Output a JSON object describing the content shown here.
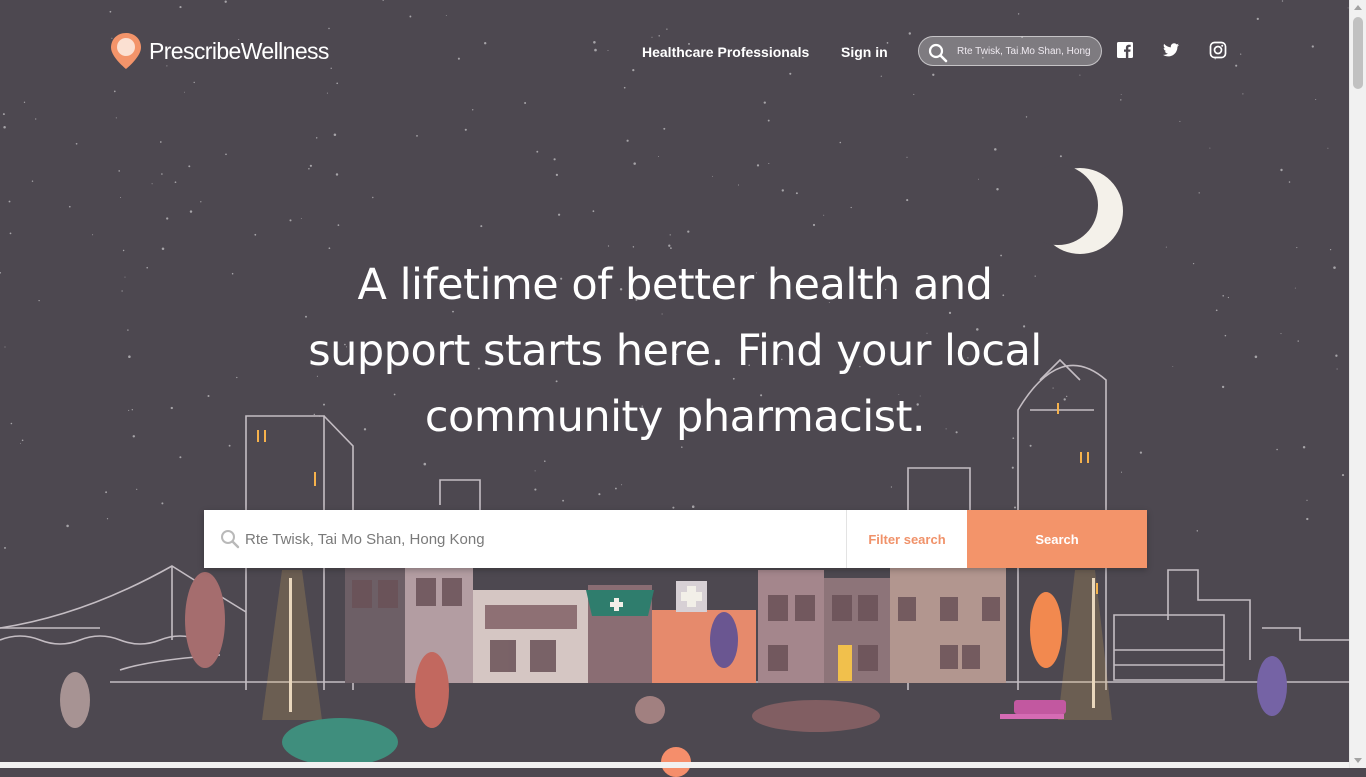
{
  "brand": {
    "name": "PrescribeWellness",
    "accent": "#f3946a"
  },
  "header": {
    "nav": [
      {
        "label": "Healthcare Professionals"
      },
      {
        "label": "Sign in"
      }
    ],
    "search": {
      "value": "Rte Twisk, Tai Mo Shan, Hong Kong",
      "icon": "search-icon"
    },
    "social": [
      {
        "icon": "facebook-icon"
      },
      {
        "icon": "twitter-icon"
      },
      {
        "icon": "instagram-icon"
      }
    ]
  },
  "hero": {
    "title": "A lifetime of better health and support starts here. Find your local community pharmacist."
  },
  "search": {
    "value": "Rte Twisk, Tai Mo Shan, Hong Kong",
    "filter_label": "Filter search",
    "button_label": "Search"
  },
  "colors": {
    "background": "#4d4850",
    "accent": "#f3946a",
    "moon": "#f4f1ea"
  }
}
